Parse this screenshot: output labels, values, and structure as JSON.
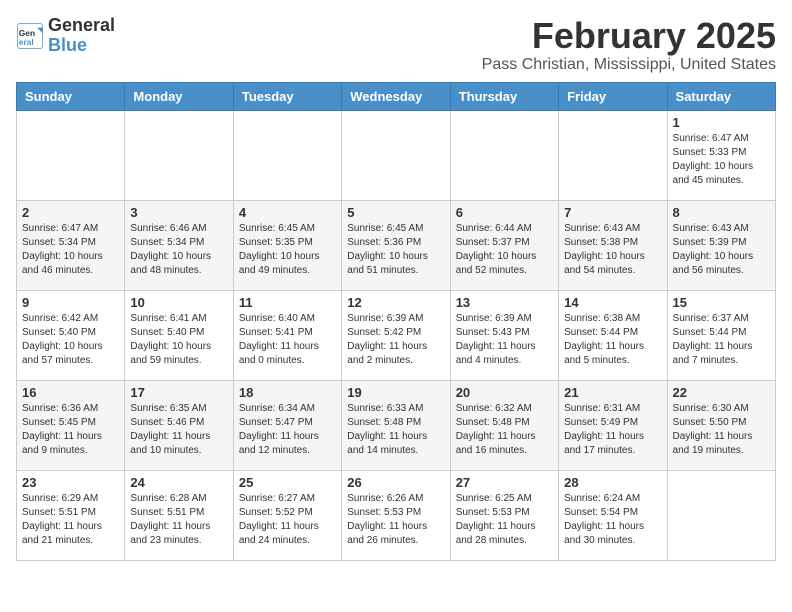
{
  "header": {
    "logo_line1": "General",
    "logo_line2": "Blue",
    "month": "February 2025",
    "location": "Pass Christian, Mississippi, United States"
  },
  "weekdays": [
    "Sunday",
    "Monday",
    "Tuesday",
    "Wednesday",
    "Thursday",
    "Friday",
    "Saturday"
  ],
  "weeks": [
    [
      {
        "day": "",
        "info": ""
      },
      {
        "day": "",
        "info": ""
      },
      {
        "day": "",
        "info": ""
      },
      {
        "day": "",
        "info": ""
      },
      {
        "day": "",
        "info": ""
      },
      {
        "day": "",
        "info": ""
      },
      {
        "day": "1",
        "info": "Sunrise: 6:47 AM\nSunset: 5:33 PM\nDaylight: 10 hours\nand 45 minutes."
      }
    ],
    [
      {
        "day": "2",
        "info": "Sunrise: 6:47 AM\nSunset: 5:34 PM\nDaylight: 10 hours\nand 46 minutes."
      },
      {
        "day": "3",
        "info": "Sunrise: 6:46 AM\nSunset: 5:34 PM\nDaylight: 10 hours\nand 48 minutes."
      },
      {
        "day": "4",
        "info": "Sunrise: 6:45 AM\nSunset: 5:35 PM\nDaylight: 10 hours\nand 49 minutes."
      },
      {
        "day": "5",
        "info": "Sunrise: 6:45 AM\nSunset: 5:36 PM\nDaylight: 10 hours\nand 51 minutes."
      },
      {
        "day": "6",
        "info": "Sunrise: 6:44 AM\nSunset: 5:37 PM\nDaylight: 10 hours\nand 52 minutes."
      },
      {
        "day": "7",
        "info": "Sunrise: 6:43 AM\nSunset: 5:38 PM\nDaylight: 10 hours\nand 54 minutes."
      },
      {
        "day": "8",
        "info": "Sunrise: 6:43 AM\nSunset: 5:39 PM\nDaylight: 10 hours\nand 56 minutes."
      }
    ],
    [
      {
        "day": "9",
        "info": "Sunrise: 6:42 AM\nSunset: 5:40 PM\nDaylight: 10 hours\nand 57 minutes."
      },
      {
        "day": "10",
        "info": "Sunrise: 6:41 AM\nSunset: 5:40 PM\nDaylight: 10 hours\nand 59 minutes."
      },
      {
        "day": "11",
        "info": "Sunrise: 6:40 AM\nSunset: 5:41 PM\nDaylight: 11 hours\nand 0 minutes."
      },
      {
        "day": "12",
        "info": "Sunrise: 6:39 AM\nSunset: 5:42 PM\nDaylight: 11 hours\nand 2 minutes."
      },
      {
        "day": "13",
        "info": "Sunrise: 6:39 AM\nSunset: 5:43 PM\nDaylight: 11 hours\nand 4 minutes."
      },
      {
        "day": "14",
        "info": "Sunrise: 6:38 AM\nSunset: 5:44 PM\nDaylight: 11 hours\nand 5 minutes."
      },
      {
        "day": "15",
        "info": "Sunrise: 6:37 AM\nSunset: 5:44 PM\nDaylight: 11 hours\nand 7 minutes."
      }
    ],
    [
      {
        "day": "16",
        "info": "Sunrise: 6:36 AM\nSunset: 5:45 PM\nDaylight: 11 hours\nand 9 minutes."
      },
      {
        "day": "17",
        "info": "Sunrise: 6:35 AM\nSunset: 5:46 PM\nDaylight: 11 hours\nand 10 minutes."
      },
      {
        "day": "18",
        "info": "Sunrise: 6:34 AM\nSunset: 5:47 PM\nDaylight: 11 hours\nand 12 minutes."
      },
      {
        "day": "19",
        "info": "Sunrise: 6:33 AM\nSunset: 5:48 PM\nDaylight: 11 hours\nand 14 minutes."
      },
      {
        "day": "20",
        "info": "Sunrise: 6:32 AM\nSunset: 5:48 PM\nDaylight: 11 hours\nand 16 minutes."
      },
      {
        "day": "21",
        "info": "Sunrise: 6:31 AM\nSunset: 5:49 PM\nDaylight: 11 hours\nand 17 minutes."
      },
      {
        "day": "22",
        "info": "Sunrise: 6:30 AM\nSunset: 5:50 PM\nDaylight: 11 hours\nand 19 minutes."
      }
    ],
    [
      {
        "day": "23",
        "info": "Sunrise: 6:29 AM\nSunset: 5:51 PM\nDaylight: 11 hours\nand 21 minutes."
      },
      {
        "day": "24",
        "info": "Sunrise: 6:28 AM\nSunset: 5:51 PM\nDaylight: 11 hours\nand 23 minutes."
      },
      {
        "day": "25",
        "info": "Sunrise: 6:27 AM\nSunset: 5:52 PM\nDaylight: 11 hours\nand 24 minutes."
      },
      {
        "day": "26",
        "info": "Sunrise: 6:26 AM\nSunset: 5:53 PM\nDaylight: 11 hours\nand 26 minutes."
      },
      {
        "day": "27",
        "info": "Sunrise: 6:25 AM\nSunset: 5:53 PM\nDaylight: 11 hours\nand 28 minutes."
      },
      {
        "day": "28",
        "info": "Sunrise: 6:24 AM\nSunset: 5:54 PM\nDaylight: 11 hours\nand 30 minutes."
      },
      {
        "day": "",
        "info": ""
      }
    ]
  ]
}
